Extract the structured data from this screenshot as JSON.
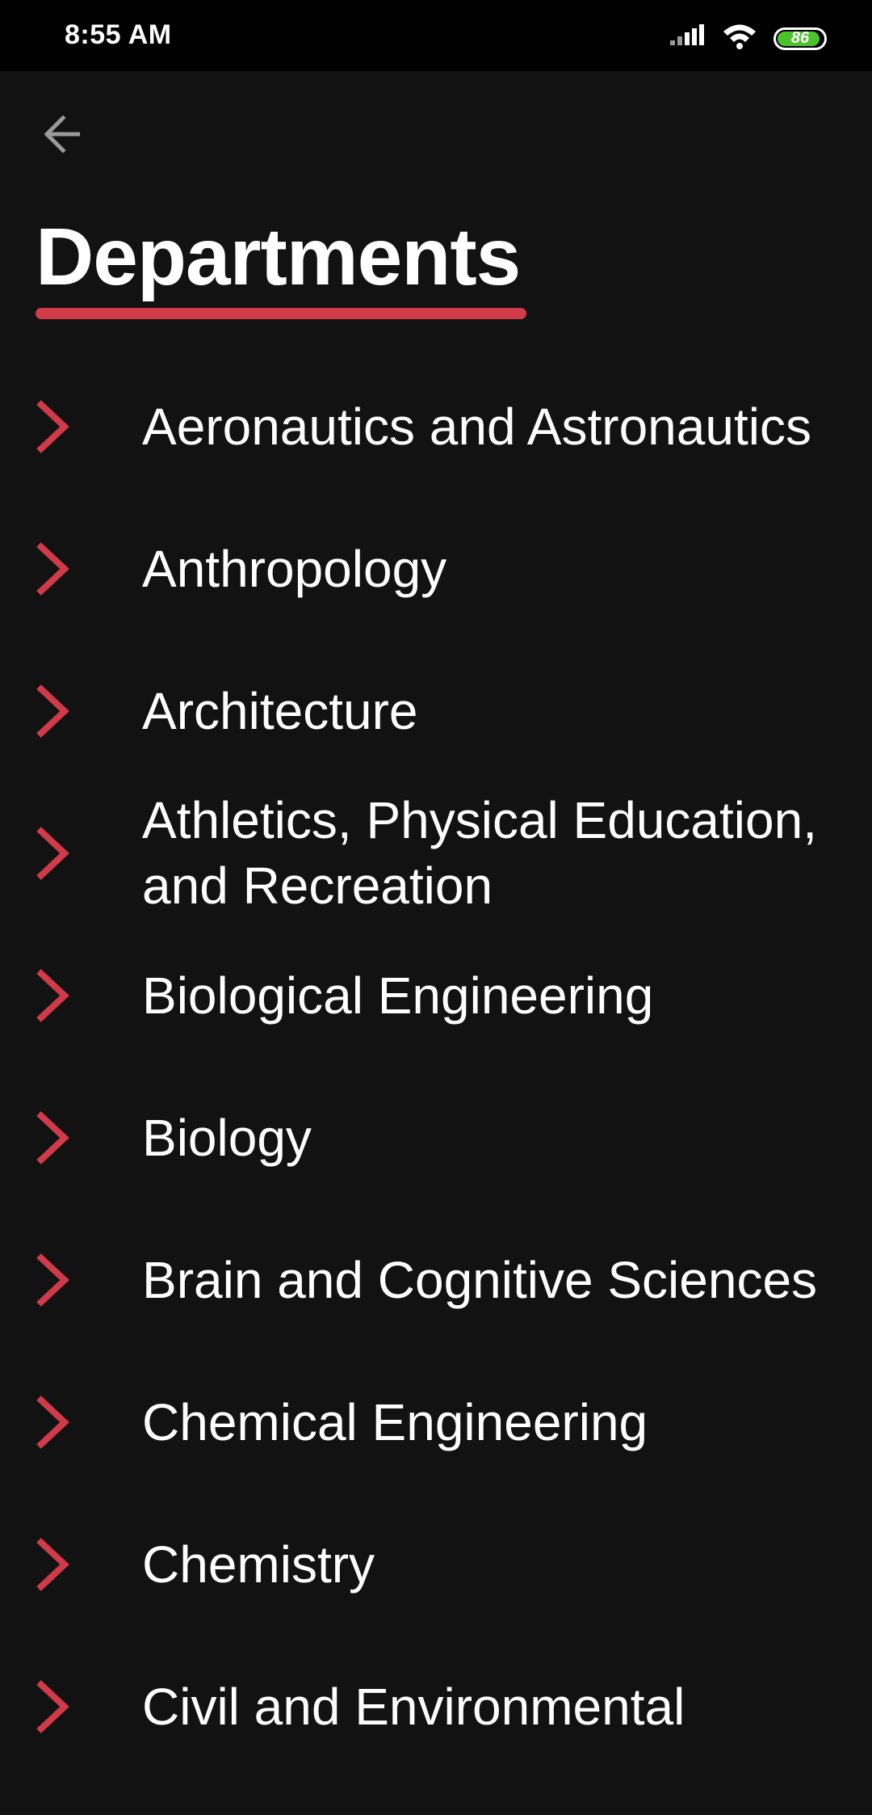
{
  "status_bar": {
    "time": "8:55 AM",
    "battery_level": "86"
  },
  "header": {
    "back_icon": "arrow-left-icon",
    "title": "Departments",
    "accent_color": "#d13a49"
  },
  "departments": [
    {
      "label": "Aeronautics and Astronautics"
    },
    {
      "label": "Anthropology"
    },
    {
      "label": "Architecture"
    },
    {
      "label": "Athletics, Physical Education, and Recreation"
    },
    {
      "label": "Biological Engineering"
    },
    {
      "label": "Biology"
    },
    {
      "label": "Brain and Cognitive Sciences"
    },
    {
      "label": "Chemical Engineering"
    },
    {
      "label": "Chemistry"
    },
    {
      "label": "Civil and Environmental"
    }
  ]
}
